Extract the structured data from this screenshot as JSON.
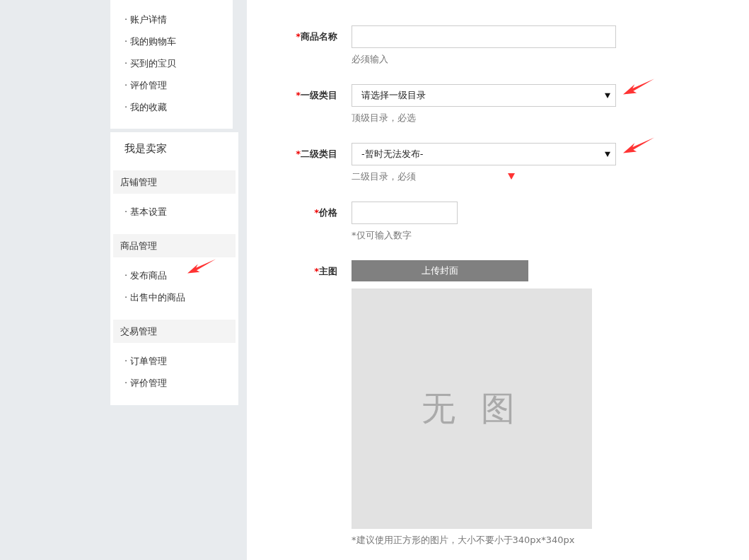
{
  "sidebar": {
    "buyer_items": [
      {
        "label": "· 账户详情"
      },
      {
        "label": "· 我的购物车"
      },
      {
        "label": "· 买到的宝贝"
      },
      {
        "label": "· 评价管理"
      },
      {
        "label": "· 我的收藏"
      }
    ],
    "seller": {
      "title": "我是卖家",
      "groups": [
        {
          "heading": "店铺管理",
          "items": [
            {
              "label": "· 基本设置"
            }
          ]
        },
        {
          "heading": "商品管理",
          "items": [
            {
              "label": "· 发布商品",
              "arrow": true
            },
            {
              "label": "· 出售中的商品"
            }
          ]
        },
        {
          "heading": "交易管理",
          "items": [
            {
              "label": "· 订单管理"
            },
            {
              "label": "· 评价管理"
            }
          ]
        }
      ]
    }
  },
  "form": {
    "rows": [
      {
        "kind": "text",
        "mark": "*",
        "label": "商品名称",
        "hint": "必须输入"
      },
      {
        "kind": "select",
        "mark": "*",
        "label": "一级类目",
        "value": "请选择一级目录",
        "hint": "顶级目录，必选",
        "arrow": true
      },
      {
        "kind": "select",
        "mark": "*",
        "label": "二级类目",
        "value": "-暂时无法发布-",
        "hint": "二级目录，必须",
        "arrow": true,
        "hint_marker": true
      },
      {
        "kind": "text",
        "mark": "*",
        "label": "价格",
        "narrow": true,
        "hint": "*仅可输入数字"
      },
      {
        "kind": "upload",
        "mark": "*",
        "label": "主图",
        "button": "上传封面",
        "empty_text": "无 图",
        "hint": "*建议使用正方形的图片，大小不要小于340px*340px"
      }
    ]
  }
}
